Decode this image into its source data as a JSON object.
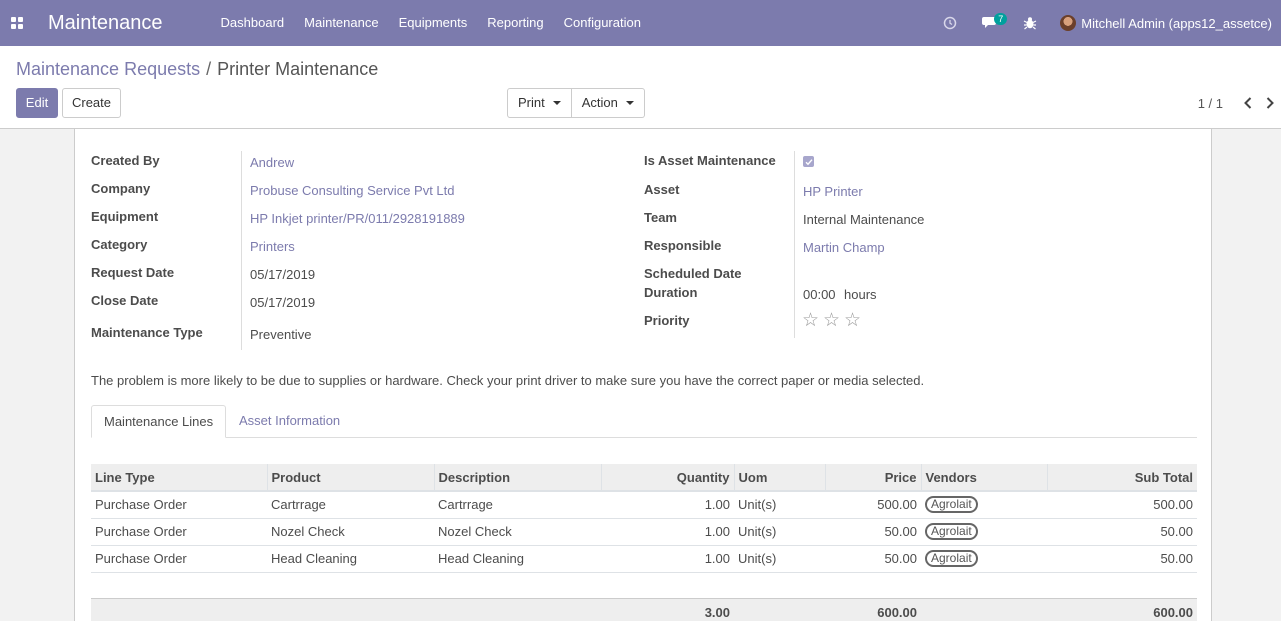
{
  "navbar": {
    "brand": "Maintenance",
    "menu": [
      "Dashboard",
      "Maintenance",
      "Equipments",
      "Reporting",
      "Configuration"
    ],
    "messages_count": "7",
    "user": "Mitchell Admin (apps12_assetce)"
  },
  "breadcrumb": {
    "parent": "Maintenance Requests",
    "separator": "/",
    "current": "Printer Maintenance"
  },
  "buttons": {
    "edit": "Edit",
    "create": "Create",
    "print": "Print",
    "action": "Action"
  },
  "pager": {
    "value": "1 / 1"
  },
  "form": {
    "left": {
      "created_by": {
        "label": "Created By",
        "value": "Andrew"
      },
      "company": {
        "label": "Company",
        "value": "Probuse Consulting Service Pvt Ltd"
      },
      "equipment": {
        "label": "Equipment",
        "value": "HP Inkjet printer/PR/011/2928191889"
      },
      "category": {
        "label": "Category",
        "value": "Printers"
      },
      "request_date": {
        "label": "Request Date",
        "value": "05/17/2019"
      },
      "close_date": {
        "label": "Close Date",
        "value": "05/17/2019"
      },
      "maintenance_type": {
        "label": "Maintenance Type",
        "value": "Preventive"
      }
    },
    "right": {
      "is_asset_maintenance": {
        "label": "Is Asset Maintenance",
        "checked": true
      },
      "asset": {
        "label": "Asset",
        "value": "HP Printer"
      },
      "team": {
        "label": "Team",
        "value": "Internal Maintenance"
      },
      "responsible": {
        "label": "Responsible",
        "value": "Martin Champ"
      },
      "scheduled_date": {
        "label": "Scheduled Date",
        "value": ""
      },
      "duration": {
        "label": "Duration",
        "value": "00:00",
        "unit": "hours"
      },
      "priority": {
        "label": "Priority",
        "stars": 0,
        "max": 3
      }
    },
    "description": "The problem is more likely to be due to supplies or hardware. Check your print driver to make sure you have the correct paper or media selected."
  },
  "tabs": [
    "Maintenance Lines",
    "Asset Information"
  ],
  "lines": {
    "columns": [
      "Line Type",
      "Product",
      "Description",
      "Quantity",
      "Uom",
      "Price",
      "Vendors",
      "Sub Total"
    ],
    "rows": [
      {
        "line_type": "Purchase Order",
        "product": "Cartrrage",
        "description": "Cartrrage",
        "quantity": "1.00",
        "uom": "Unit(s)",
        "price": "500.00",
        "vendor": "Agrolait",
        "subtotal": "500.00"
      },
      {
        "line_type": "Purchase Order",
        "product": "Nozel Check",
        "description": "Nozel Check",
        "quantity": "1.00",
        "uom": "Unit(s)",
        "price": "50.00",
        "vendor": "Agrolait",
        "subtotal": "50.00"
      },
      {
        "line_type": "Purchase Order",
        "product": "Head Cleaning",
        "description": "Head Cleaning",
        "quantity": "1.00",
        "uom": "Unit(s)",
        "price": "50.00",
        "vendor": "Agrolait",
        "subtotal": "50.00"
      }
    ],
    "totals": {
      "quantity": "3.00",
      "price": "600.00",
      "subtotal": "600.00"
    }
  }
}
